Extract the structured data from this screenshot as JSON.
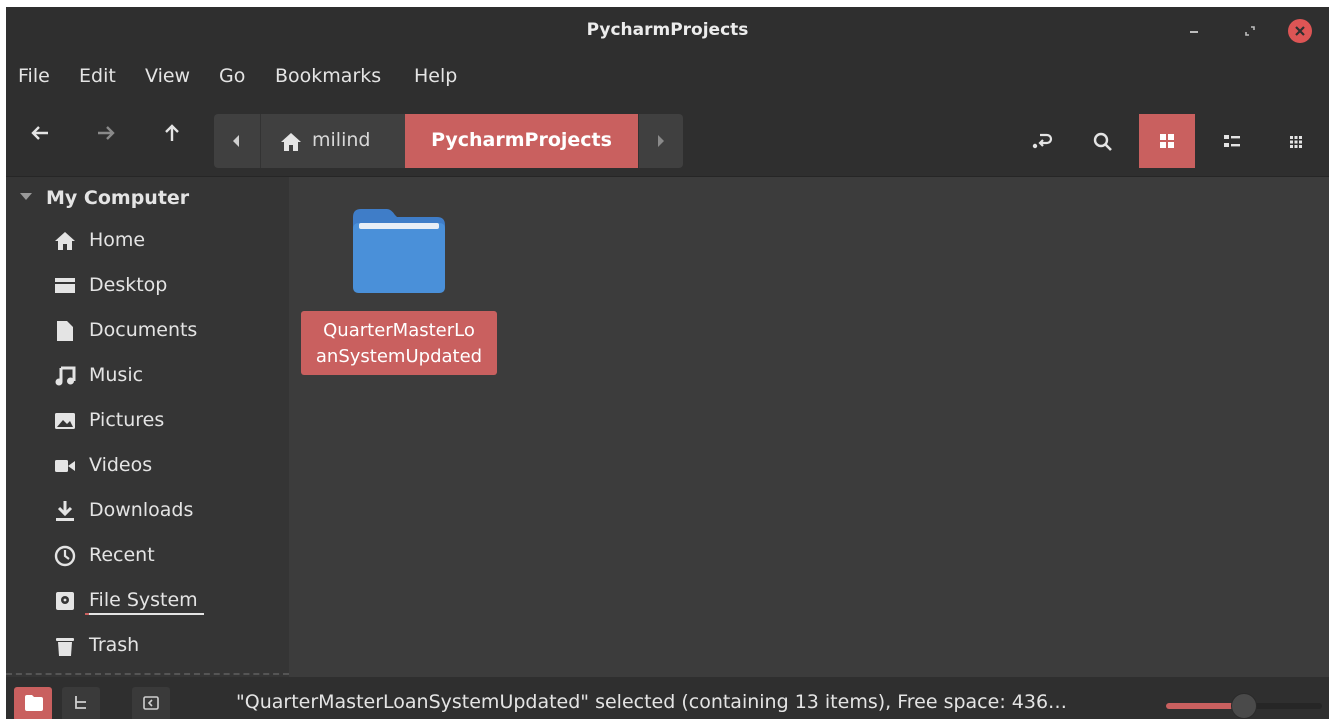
{
  "window": {
    "title": "PycharmProjects"
  },
  "menu": [
    "File",
    "Edit",
    "View",
    "Go",
    "Bookmarks",
    "Help"
  ],
  "toolbar": {
    "breadcrumb_home": "milind",
    "breadcrumb_current": "PycharmProjects",
    "active_view": "icon-view"
  },
  "sidebar": {
    "header": "My Computer",
    "items": [
      {
        "label": "Home",
        "icon": "home-icon"
      },
      {
        "label": "Desktop",
        "icon": "desktop-icon"
      },
      {
        "label": "Documents",
        "icon": "document-icon"
      },
      {
        "label": "Music",
        "icon": "music-icon"
      },
      {
        "label": "Pictures",
        "icon": "pictures-icon"
      },
      {
        "label": "Videos",
        "icon": "video-icon"
      },
      {
        "label": "Downloads",
        "icon": "download-icon"
      },
      {
        "label": "Recent",
        "icon": "recent-icon"
      },
      {
        "label": "File System",
        "icon": "drive-icon"
      },
      {
        "label": "Trash",
        "icon": "trash-icon"
      }
    ]
  },
  "files": [
    {
      "name_line1": "QuarterMasterLo",
      "name_line2": "anSystemUpdated",
      "type": "folder",
      "selected": true
    }
  ],
  "status": {
    "text": "\"QuarterMasterLoanSystemUpdated\" selected (containing 13 items), Free space: 436…",
    "zoom_level_fraction": 0.5
  },
  "colors": {
    "accent": "#c9605f",
    "folder": "#4a90d9",
    "background": "#3c3c3c",
    "bar": "#2f2f2f"
  }
}
